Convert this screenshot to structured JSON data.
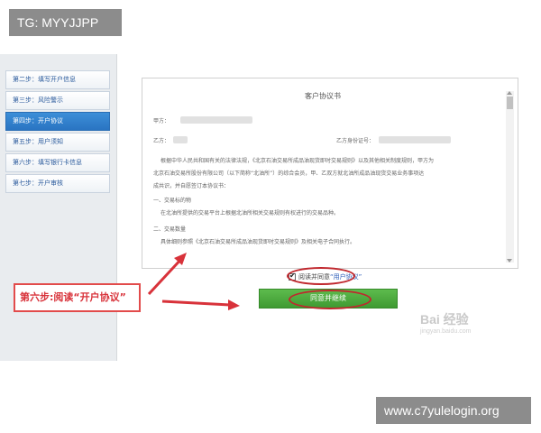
{
  "watermarks": {
    "top_left": "TG: MYYJJPP",
    "bottom_right": "www.c7yulelogin.org"
  },
  "steps": [
    {
      "label": "第二步：填写开户信息",
      "active": false
    },
    {
      "label": "第三步：风险警示",
      "active": false
    },
    {
      "label": "第四步：开户协议",
      "active": true
    },
    {
      "label": "第五步：用户须知",
      "active": false
    },
    {
      "label": "第六步：填写银行卡信息",
      "active": false
    },
    {
      "label": "第七步：开户审核",
      "active": false
    }
  ],
  "doc": {
    "title": "客户协议书",
    "party_a": "甲方：",
    "party_b": "乙方：",
    "id_label": "乙方身份证号：",
    "para1_line1": "根据中华人民共和国有关的法律法规，《北京石油交易所成品油现货即时交易规则》以及其他相关制度规则，甲方为",
    "para1_line2": "北京石油交易所股份有限公司（以下简称“北油所”）的综合会员，甲、乙双方就北油所成品油现货交易业务事项达",
    "para1_line3": "成共识，并自愿签订本协议书：",
    "sec1_title": "一、交易标的物",
    "sec1_text": "在北油所提供的交易平台上根据北油所相关交易规则有权进行的交易品种。",
    "sec2_title": "二、交易数量",
    "sec2_text": "具体细则参照《北京石油交易所成品油现货即时交易规则》及相关电子合同执行。"
  },
  "agree": {
    "text": "阅读并同意",
    "link": "“用户协议”"
  },
  "buttons": {
    "agree_continue": "同意并继续"
  },
  "annotation": "第六步:阅读“开户协议”",
  "baidu": {
    "logo": "Bai 经验",
    "sub": "jingyan.baidu.com"
  },
  "colors": {
    "annotation_red": "#c0272d",
    "active_step_blue": "#2a74c2",
    "button_green": "#3f9a32"
  }
}
